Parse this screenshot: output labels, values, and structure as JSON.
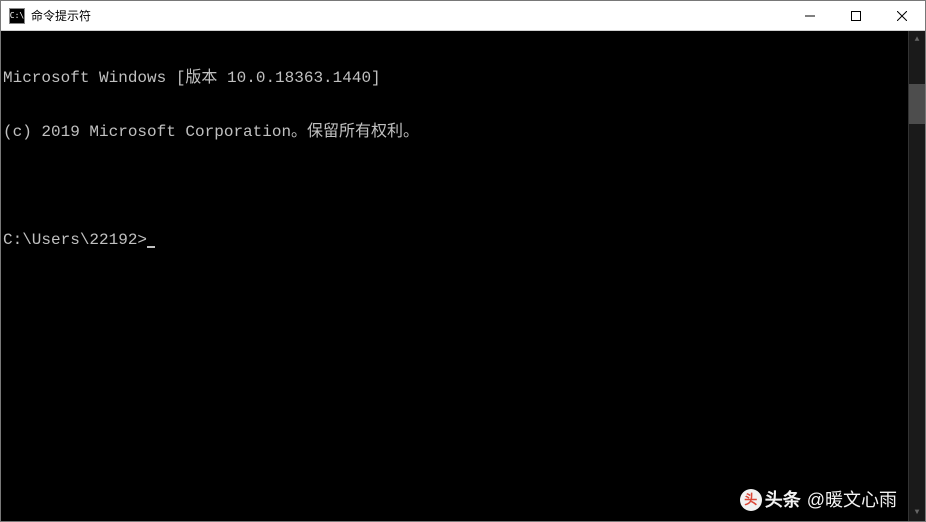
{
  "window": {
    "icon_text": "C:\\",
    "title": "命令提示符"
  },
  "terminal": {
    "line1": "Microsoft Windows [版本 10.0.18363.1440]",
    "line2": "(c) 2019 Microsoft Corporation。保留所有权利。",
    "blank": "",
    "prompt": "C:\\Users\\22192>"
  },
  "watermark": {
    "logo_char": "头",
    "logo_text": "头条",
    "user": "@暖文心雨"
  }
}
